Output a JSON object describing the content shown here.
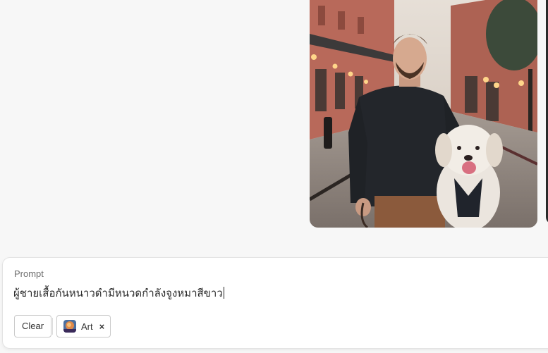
{
  "image": {
    "icon": "generated-image",
    "subject": "man-with-white-dog"
  },
  "prompt": {
    "label": "Prompt",
    "value": "ผู้ชายเสื้อกันหนาวดำมีหนวดกำลังจูงหมาสีขาว"
  },
  "actions": {
    "clear_label": "Clear"
  },
  "style_chip": {
    "label": "Art",
    "close_glyph": "×",
    "icon": "art-style-thumbnail"
  },
  "colors": {
    "page_bg": "#f7f7f7",
    "panel_bg": "#ffffff",
    "border": "#c9c9c9",
    "text": "#333333",
    "muted": "#6e6e6e"
  }
}
